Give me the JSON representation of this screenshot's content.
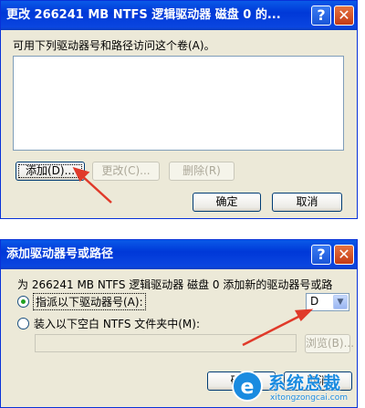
{
  "dialog1": {
    "title": "更改 266241 MB NTFS 逻辑驱动器 磁盘 0 的...",
    "description": "可用下列驱动器号和路径访问这个卷(A)。",
    "add_button": "添加(D)...",
    "change_button": "更改(C)...",
    "remove_button": "删除(R)",
    "ok_button": "确定",
    "cancel_button": "取消"
  },
  "dialog2": {
    "title": "添加驱动器号或路径",
    "description": "为 266241 MB NTFS 逻辑驱动器 磁盘 0 添加新的驱动器号或路",
    "radio_assign_label": "指派以下驱动器号(A):",
    "radio_mount_label": "装入以下空白 NTFS 文件夹中(M):",
    "drive_letter": "D",
    "browse_button": "浏览(B)...",
    "ok_button": "确定",
    "cancel_button": "取消",
    "selected_option": "assign"
  },
  "titlebar_buttons": {
    "help": "?",
    "close": "✕"
  },
  "combo_arrow": "▼",
  "watermark": {
    "logo_letter": "e",
    "title": "系统总裁",
    "url": "xitongzongcai.com"
  },
  "colors": {
    "dialog_bg": "#ece9d8",
    "titlebar_blue": "#0a46e0",
    "annotation_arrow": "#e03a2a",
    "watermark_blue": "#1a8be0"
  }
}
